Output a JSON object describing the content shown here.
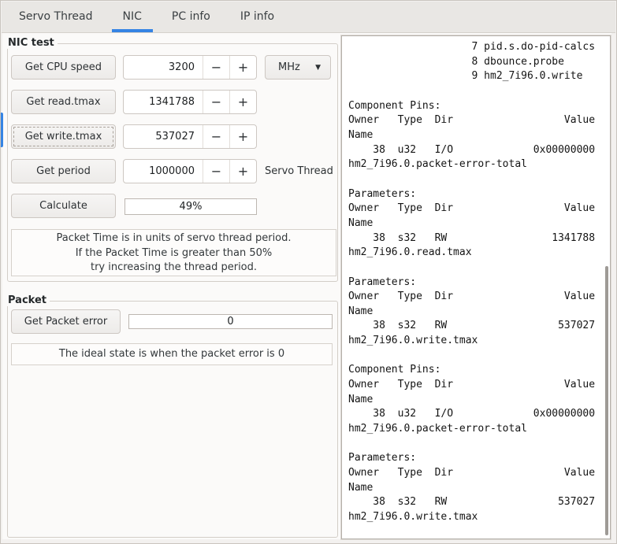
{
  "colors": {
    "accent": "#3584e4"
  },
  "tabs": [
    {
      "label": "Servo Thread"
    },
    {
      "label": "NIC"
    },
    {
      "label": "PC info"
    },
    {
      "label": "IP info"
    }
  ],
  "controls": {
    "minus": "−",
    "plus": "+"
  },
  "icons": {
    "dropdown_arrow": "▼"
  },
  "nic_test": {
    "label": "NIC test",
    "rows": [
      {
        "button": "Get CPU speed",
        "value": "3200",
        "unit": "MHz"
      },
      {
        "button": "Get read.tmax",
        "value": "1341788"
      },
      {
        "button": "Get write.tmax",
        "value": "537027"
      },
      {
        "button": "Get period",
        "value": "1000000",
        "note": "Servo Thread"
      }
    ],
    "calculate_button": "Calculate",
    "packet_time_percent": "49%",
    "info_lines": {
      "line1": "Packet Time is in units of servo thread period.",
      "line2": "If the Packet Time is greater than 50%",
      "line3": "try increasing the thread period."
    }
  },
  "packet": {
    "label": "Packet",
    "button": "Get Packet error",
    "error_value": "0",
    "info": "The ideal state is when the packet error is 0"
  },
  "terminal": {
    "lines": [
      "                    7 pid.s.do-pid-calcs",
      "                    8 dbounce.probe",
      "                    9 hm2_7i96.0.write",
      "",
      "Component Pins:",
      "Owner   Type  Dir                  Value",
      "Name",
      "    38  u32   I/O             0x00000000",
      "hm2_7i96.0.packet-error-total",
      "",
      "Parameters:",
      "Owner   Type  Dir                  Value",
      "Name",
      "    38  s32   RW                 1341788",
      "hm2_7i96.0.read.tmax",
      "",
      "Parameters:",
      "Owner   Type  Dir                  Value",
      "Name",
      "    38  s32   RW                  537027",
      "hm2_7i96.0.write.tmax",
      "",
      "Component Pins:",
      "Owner   Type  Dir                  Value",
      "Name",
      "    38  u32   I/O             0x00000000",
      "hm2_7i96.0.packet-error-total",
      "",
      "Parameters:",
      "Owner   Type  Dir                  Value",
      "Name",
      "    38  s32   RW                  537027",
      "hm2_7i96.0.write.tmax"
    ]
  }
}
